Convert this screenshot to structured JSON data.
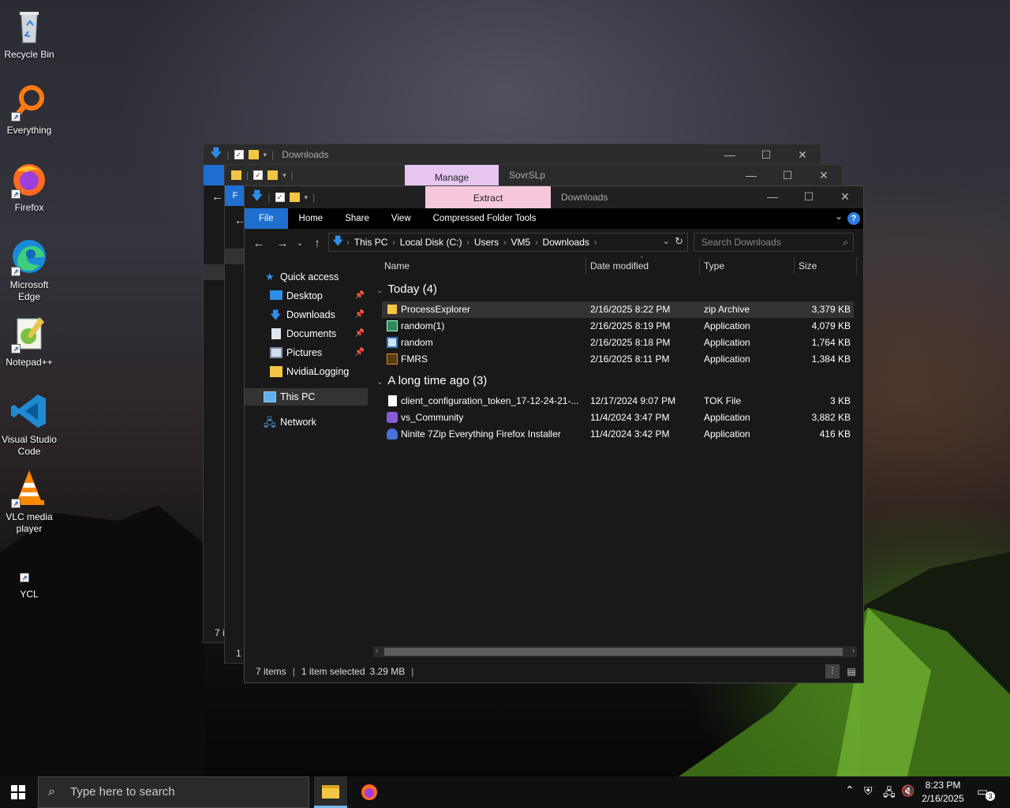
{
  "desktop": {
    "icons": [
      {
        "label": "Recycle Bin",
        "icon": "recycle-bin-icon"
      },
      {
        "label": "Everything",
        "icon": "everything-search-icon"
      },
      {
        "label": "Firefox",
        "icon": "firefox-icon"
      },
      {
        "label": "Microsoft Edge",
        "icon": "edge-icon"
      },
      {
        "label": "Notepad++",
        "icon": "notepad-plus-plus-icon"
      },
      {
        "label": "Visual Studio Code",
        "icon": "vscode-icon"
      },
      {
        "label": "VLC media player",
        "icon": "vlc-icon"
      },
      {
        "label": "YCL",
        "icon": "ycl-icon"
      }
    ]
  },
  "back_window_1": {
    "title": "Downloads",
    "status_fragment": "7 i"
  },
  "back_window_2": {
    "manage_tab": "Manage",
    "title": "SovrSLp",
    "status_fragment": "1 i",
    "file_fragment": "F"
  },
  "main": {
    "context_tab": "Extract",
    "title": "Downloads",
    "ribbon_tabs": [
      "File",
      "Home",
      "Share",
      "View",
      "Compressed Folder Tools"
    ],
    "breadcrumbs": [
      "This PC",
      "Local Disk (C:)",
      "Users",
      "VM5",
      "Downloads"
    ],
    "search_placeholder": "Search Downloads",
    "nav": {
      "quick_access": "Quick access",
      "items": [
        {
          "label": "Desktop",
          "pinned": true
        },
        {
          "label": "Downloads",
          "pinned": true
        },
        {
          "label": "Documents",
          "pinned": true
        },
        {
          "label": "Pictures",
          "pinned": true
        },
        {
          "label": "NvidiaLogging",
          "pinned": false
        }
      ],
      "this_pc": "This PC",
      "network": "Network"
    },
    "columns": [
      "Name",
      "Date modified",
      "Type",
      "Size"
    ],
    "groups": [
      {
        "title": "Today (4)",
        "rows": [
          {
            "name": "ProcessExplorer",
            "date": "2/16/2025 8:22 PM",
            "type": "zip Archive",
            "size": "3,379 KB",
            "icon": "zip-archive-icon",
            "selected": true
          },
          {
            "name": "random(1)",
            "date": "2/16/2025 8:19 PM",
            "type": "Application",
            "size": "4,079 KB",
            "icon": "application-icon",
            "selected": false
          },
          {
            "name": "random",
            "date": "2/16/2025 8:18 PM",
            "type": "Application",
            "size": "1,764 KB",
            "icon": "application-icon",
            "selected": false
          },
          {
            "name": "FMRS",
            "date": "2/16/2025 8:11 PM",
            "type": "Application",
            "size": "1,384 KB",
            "icon": "application-icon",
            "selected": false
          }
        ]
      },
      {
        "title": "A long time ago (3)",
        "rows": [
          {
            "name": "client_configuration_token_17-12-24-21-...",
            "date": "12/17/2024 9:07 PM",
            "type": "TOK File",
            "size": "3 KB",
            "icon": "file-icon",
            "selected": false
          },
          {
            "name": "vs_Community",
            "date": "11/4/2024 3:47 PM",
            "type": "Application",
            "size": "3,882 KB",
            "icon": "visual-studio-installer-icon",
            "selected": false
          },
          {
            "name": "Ninite 7Zip Everything Firefox Installer",
            "date": "11/4/2024 3:42 PM",
            "type": "Application",
            "size": "416 KB",
            "icon": "ninite-icon",
            "selected": false
          }
        ]
      }
    ],
    "status": {
      "items": "7 items",
      "selected": "1 item selected",
      "size": "3.29 MB"
    }
  },
  "taskbar": {
    "search_placeholder": "Type here to search",
    "time": "8:23 PM",
    "date": "2/16/2025",
    "notification_count": "3"
  }
}
